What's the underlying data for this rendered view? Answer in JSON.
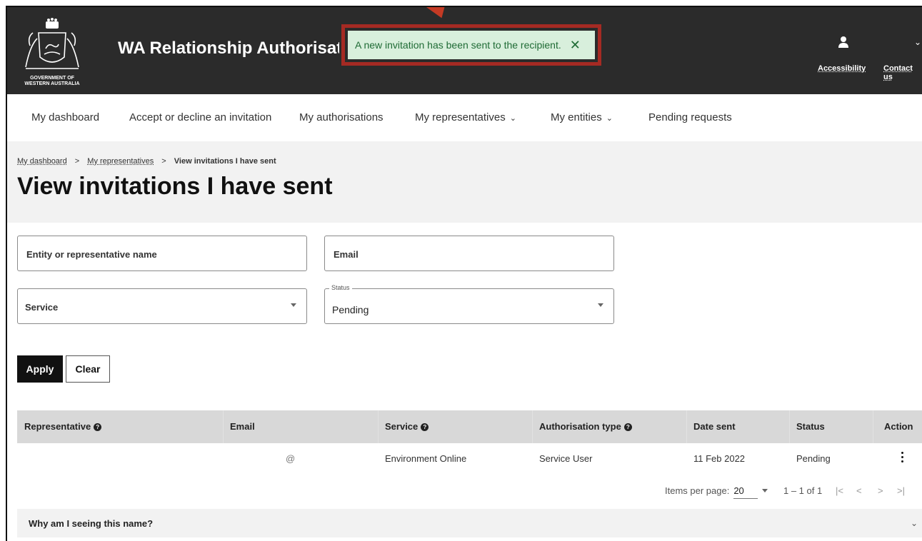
{
  "header": {
    "app_title": "WA Relationship Authorisations",
    "crest_text": "GOVERNMENT OF\nWESTERN AUSTRALIA",
    "accessibility_label": "Accessibility",
    "contact_label": "Contact us"
  },
  "toast": {
    "message": "A new invitation has been sent to the recipient.",
    "close_glyph": "✕",
    "border_color": "#a52a23"
  },
  "nav": {
    "items": [
      {
        "label": "My dashboard"
      },
      {
        "label": "Accept or decline an invitation"
      },
      {
        "label": "My authorisations"
      },
      {
        "label": "My representatives"
      },
      {
        "label": "My entities"
      },
      {
        "label": "Pending requests"
      }
    ]
  },
  "breadcrumb": {
    "items": [
      "My dashboard",
      "My representatives"
    ],
    "current": "View invitations I have sent",
    "separator": ">"
  },
  "page_title": "View invitations I have sent",
  "filters": {
    "name_placeholder": "Entity or representative name",
    "email_placeholder": "Email",
    "service_value": "Service",
    "status_label": "Status",
    "status_value": "Pending"
  },
  "buttons": {
    "apply": "Apply",
    "clear": "Clear"
  },
  "table": {
    "headers": [
      "Representative",
      "Email",
      "Service",
      "Authorisation type",
      "Date sent",
      "Status",
      "Action"
    ],
    "rows": [
      {
        "representative": "",
        "email": "@",
        "service": "Environment Online",
        "authorisation_type": "Service User",
        "date_sent": "11 Feb 2022",
        "status": "Pending"
      }
    ]
  },
  "pager": {
    "items_per_page_label": "Items per page:",
    "items_per_page_value": "20",
    "range": "1 – 1 of 1"
  },
  "accordion": {
    "title": "Why am I seeing this name?"
  }
}
